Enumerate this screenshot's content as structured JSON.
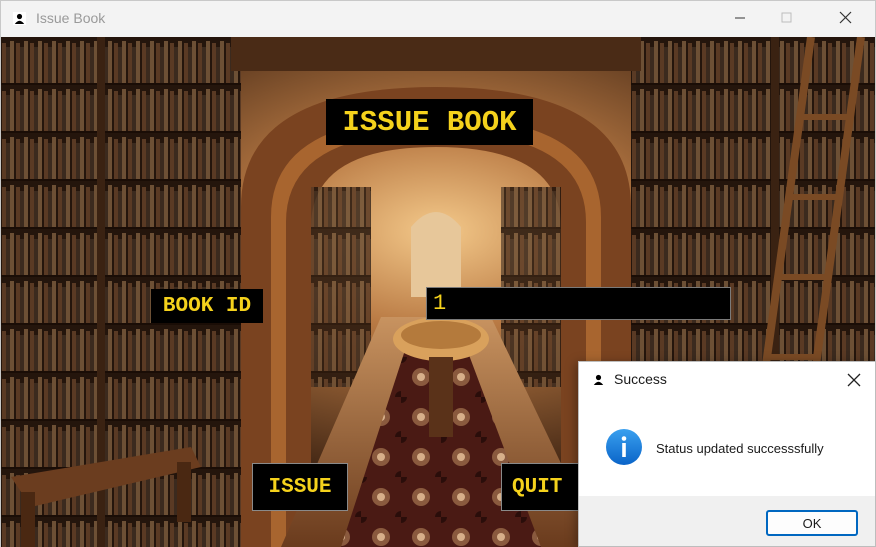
{
  "window": {
    "title": "Issue Book"
  },
  "form": {
    "heading": "ISSUE BOOK",
    "book_id_label": "BOOK ID",
    "book_id_value": "1",
    "issue_label": "ISSUE",
    "quit_label": "QUIT"
  },
  "dialog": {
    "title": "Success",
    "message": "Status updated successsfully",
    "ok_label": "OK",
    "icon": "info-icon"
  },
  "colors": {
    "label_text": "#f5d21c",
    "label_bg": "#000000",
    "accent": "#0067c0"
  }
}
